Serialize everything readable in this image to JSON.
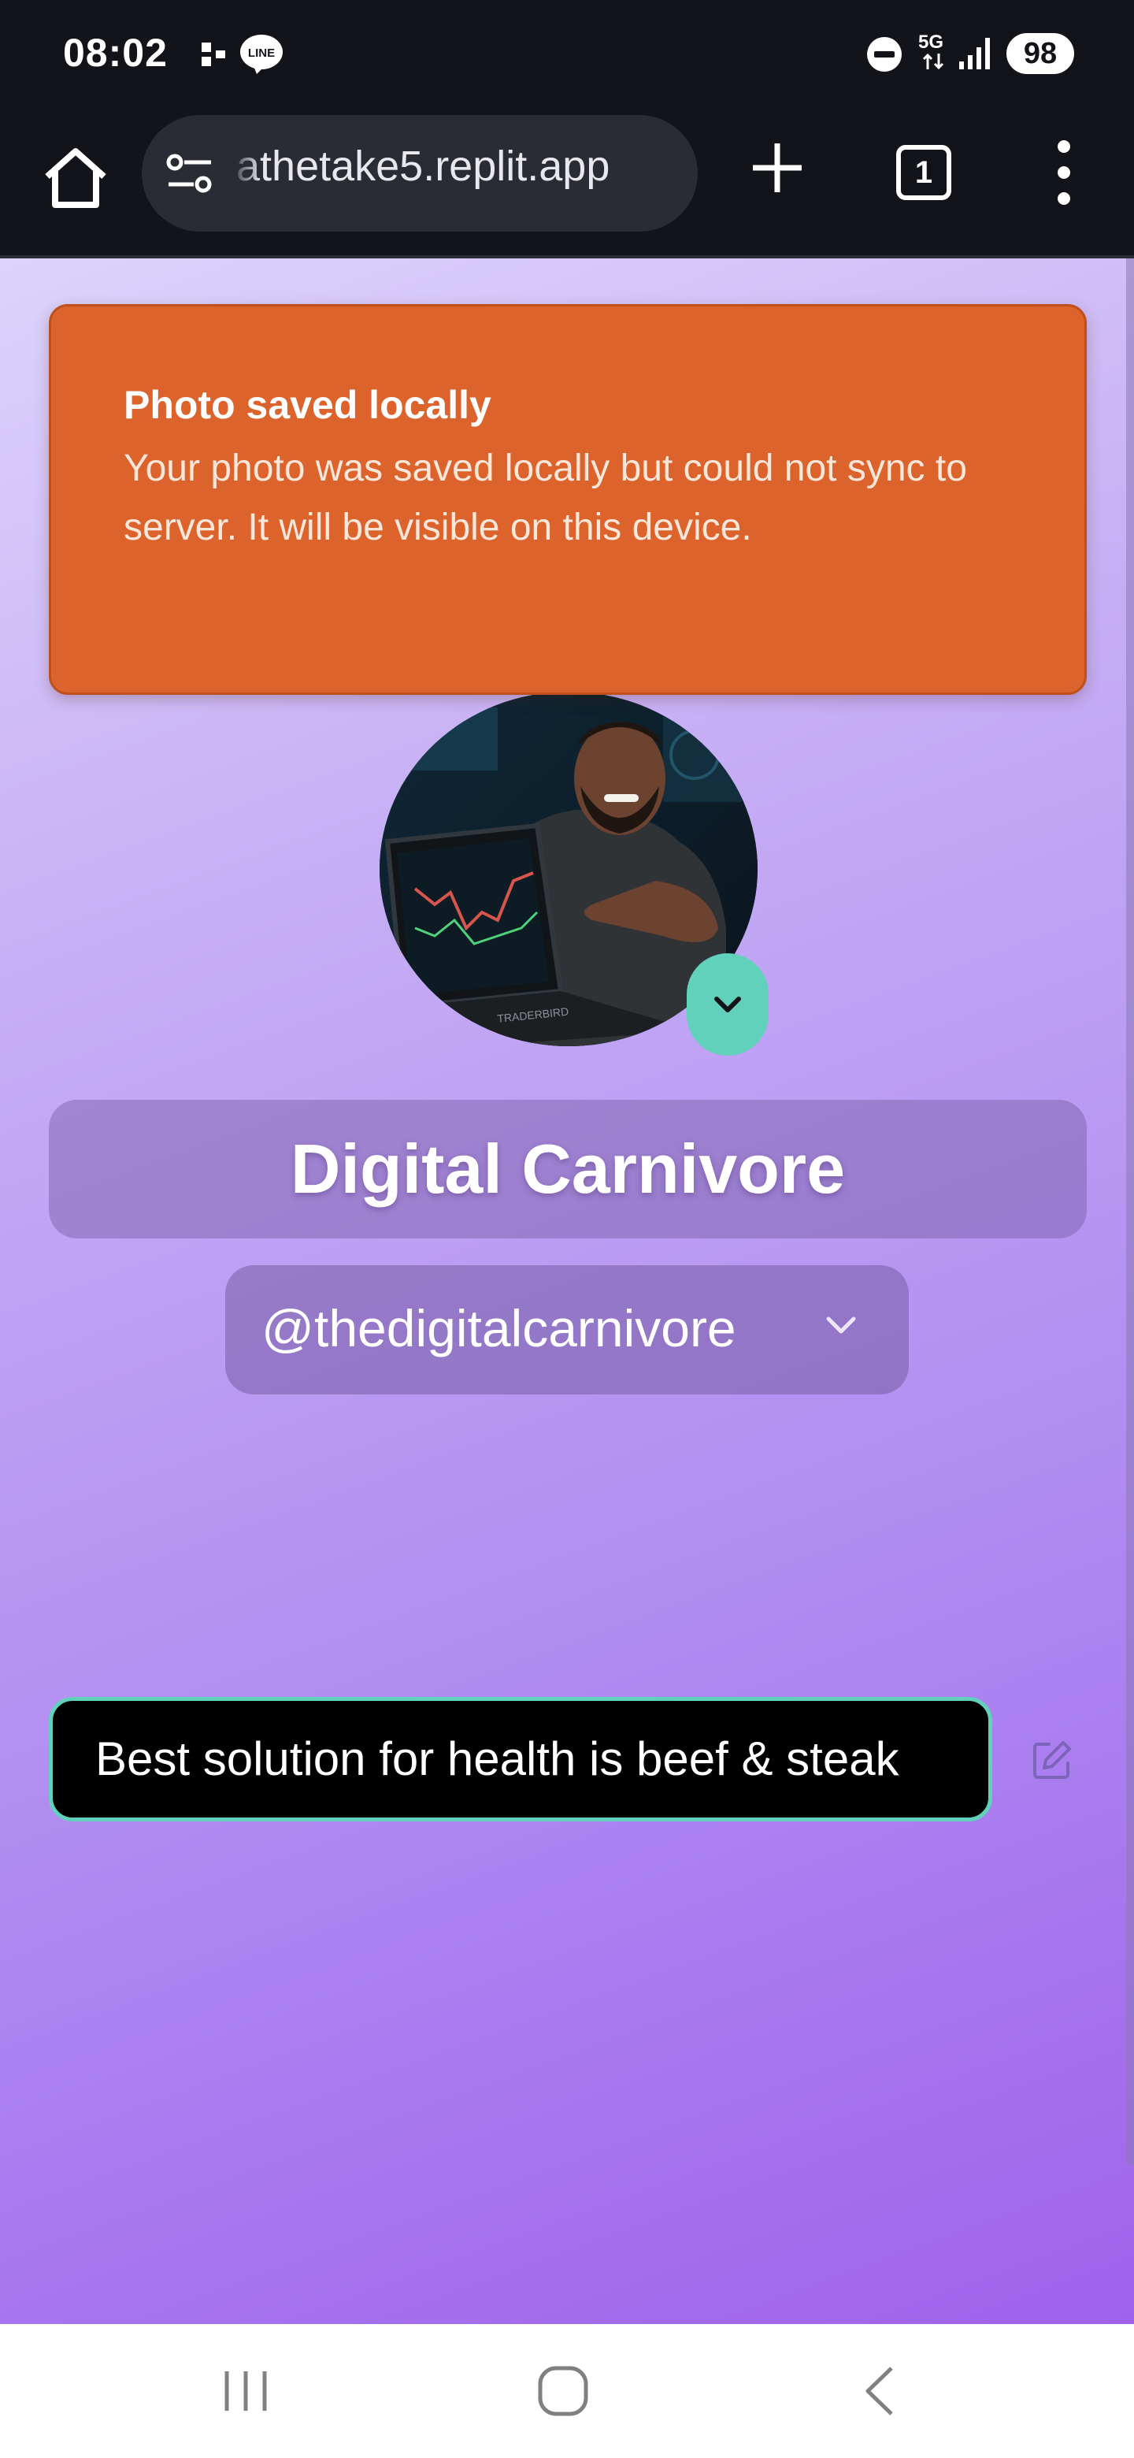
{
  "status_bar": {
    "time": "08:02",
    "battery": "98",
    "network": "5G",
    "icons": [
      "dnd-icon",
      "line-app-icon",
      "signal-icon"
    ]
  },
  "browser": {
    "url": "athetake5.replit.app",
    "tab_count": "1"
  },
  "toast": {
    "title": "Photo saved locally",
    "message": "Your photo was saved locally but could not sync to server. It will be visible on this device.",
    "color": "#dc632c"
  },
  "profile": {
    "name": "Digital Carnivore",
    "handle": "@thedigitalcarnivore",
    "bio": "Best solution for health is beef & steak",
    "avatar_laptop_text": "TRADERBIRD",
    "accent_color": "#62d1bb"
  },
  "nav": {
    "items": [
      "recents-icon",
      "home-icon",
      "back-icon"
    ]
  }
}
